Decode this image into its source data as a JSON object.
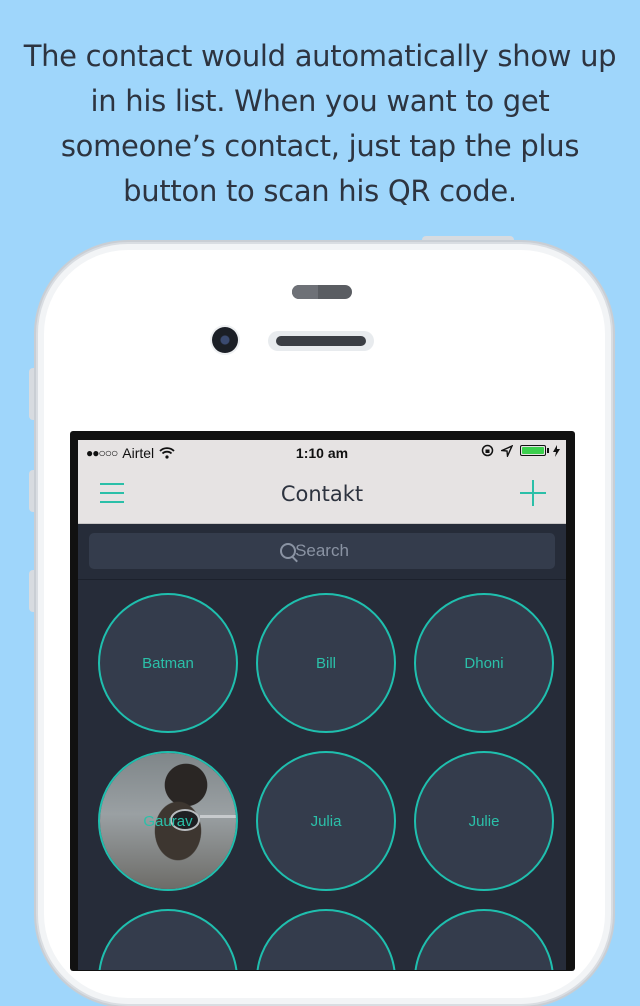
{
  "caption": "The contact would automatically show up in his list. When you want to get someone’s contact, just tap the plus button to scan his QR code.",
  "statusbar": {
    "signal": "●●○○○",
    "carrier": "Airtel",
    "time": "1:10 am",
    "battery_color": "#3ccf4e"
  },
  "navbar": {
    "title": "Contakt",
    "menu_icon": "hamburger-icon",
    "add_icon": "plus-icon"
  },
  "search": {
    "placeholder": "Search"
  },
  "contacts": [
    {
      "name": "Batman",
      "has_photo": false
    },
    {
      "name": "Bill",
      "has_photo": false
    },
    {
      "name": "Dhoni",
      "has_photo": false
    },
    {
      "name": "Gaurav",
      "has_photo": true
    },
    {
      "name": "Julia",
      "has_photo": false
    },
    {
      "name": "Julie",
      "has_photo": false
    },
    {
      "name": "",
      "has_photo": false
    },
    {
      "name": "",
      "has_photo": false
    },
    {
      "name": "",
      "has_photo": false
    }
  ],
  "colors": {
    "background": "#9fd6fb",
    "accent": "#2bbfa8",
    "screen_bg": "#262c39",
    "bar_bg": "#e6e3e3"
  }
}
